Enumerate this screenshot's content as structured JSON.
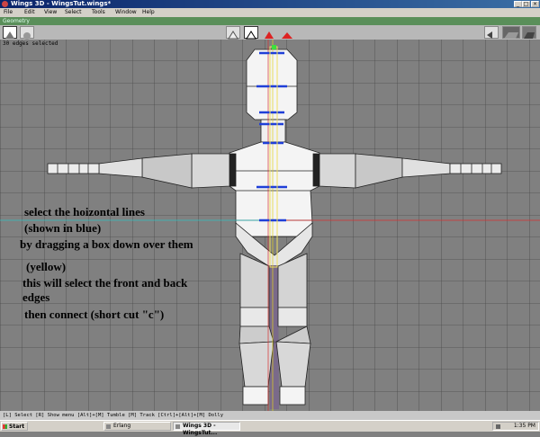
{
  "window": {
    "title": "Wings 3D - WingsTut.wings*"
  },
  "menu": [
    "File",
    "Edit",
    "View",
    "Select",
    "Tools",
    "Window",
    "Help"
  ],
  "geometry_title": "Geometry",
  "status_message": "30 edges selected",
  "instructions": {
    "line1": "select the hoizontal lines",
    "line2": "(shown in blue)",
    "line3": "by dragging a box down over them",
    "line4": "(yellow)",
    "line5": "this will select the front and back",
    "line6": "edges",
    "line7": "then connect (short cut \"c\")"
  },
  "info_line": "[L] Select  [R] Show menu  [Alt]+[M] Tumble  [M] Track  [Ctrl]+[Alt]+[M] Dolly",
  "taskbar": {
    "start": "Start",
    "tasks": [
      "Erlang",
      "Wings 3D - WingsTut..."
    ],
    "clock": "1:35 PM"
  },
  "colors": {
    "viewport_bg": "#808080",
    "grid": "#4a4a4a",
    "selected_edge": "#1f3fd8",
    "marquee": "#f0e060",
    "x_axis": "#d83030",
    "y_axis": "#e0d020",
    "z_axis": "#30c0c0"
  }
}
